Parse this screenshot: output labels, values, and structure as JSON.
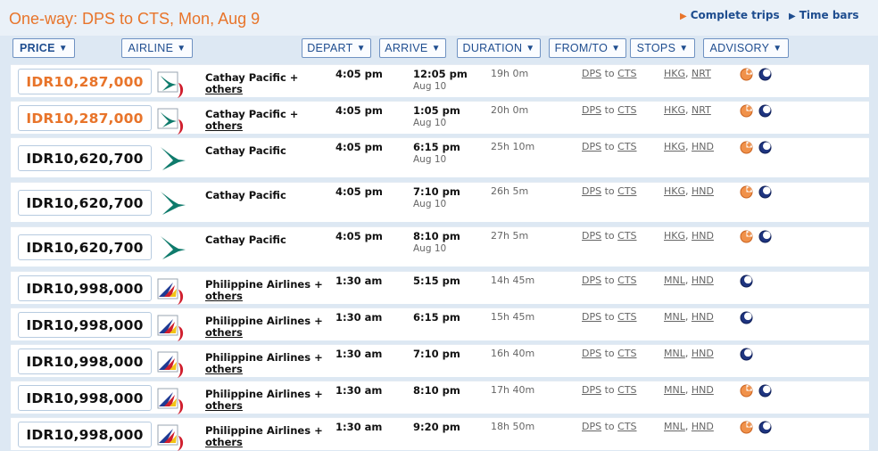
{
  "header": {
    "title": "One-way: DPS to CTS, Mon, Aug 9",
    "links": {
      "complete_trips": "Complete trips",
      "time_bars": "Time bars"
    }
  },
  "columns": [
    {
      "label": "PRICE",
      "name": "price",
      "active": true
    },
    {
      "label": "AIRLINE",
      "name": "airline",
      "active": false
    },
    {
      "label": "DEPART",
      "name": "depart",
      "active": false
    },
    {
      "label": "ARRIVE",
      "name": "arrive",
      "active": false
    },
    {
      "label": "DURATION",
      "name": "duration",
      "active": false
    },
    {
      "label": "FROM/TO",
      "name": "from-to",
      "active": false
    },
    {
      "label": "STOPS",
      "name": "stops",
      "active": false
    },
    {
      "label": "ADVISORY",
      "name": "advisory",
      "active": false
    }
  ],
  "common": {
    "to_word": "to"
  },
  "colors": {
    "accent": "#e8742a",
    "link": "#1e4d8f",
    "cathay_green": "#0f7b6c",
    "philippine_red": "#d01f2e",
    "philippine_blue": "#1f3a93"
  },
  "flights": [
    {
      "price": "IDR10,287,000",
      "highlight": true,
      "logo": "cathay-multi-icon",
      "airline_main": "Cathay Pacific +",
      "airline_extra": "others",
      "depart": "4:05 pm",
      "arrive": "12:05 pm",
      "arrive_date": "Aug 10",
      "duration": "19h 0m",
      "from": "DPS",
      "to": "CTS",
      "stops": [
        "HKG",
        "NRT"
      ],
      "advisory": [
        "sun-moon-icon",
        "moon-icon"
      ]
    },
    {
      "price": "IDR10,287,000",
      "highlight": true,
      "logo": "cathay-multi-icon",
      "airline_main": "Cathay Pacific +",
      "airline_extra": "others",
      "depart": "4:05 pm",
      "arrive": "1:05 pm",
      "arrive_date": "Aug 10",
      "duration": "20h 0m",
      "from": "DPS",
      "to": "CTS",
      "stops": [
        "HKG",
        "NRT"
      ],
      "advisory": [
        "sun-moon-icon",
        "moon-icon"
      ]
    },
    {
      "price": "IDR10,620,700",
      "highlight": false,
      "logo": "cathay-icon",
      "airline_main": "Cathay Pacific",
      "airline_extra": "",
      "depart": "4:05 pm",
      "arrive": "6:15 pm",
      "arrive_date": "Aug 10",
      "duration": "25h 10m",
      "from": "DPS",
      "to": "CTS",
      "stops": [
        "HKG",
        "HND"
      ],
      "advisory": [
        "sun-moon-icon",
        "moon-icon"
      ]
    },
    {
      "price": "IDR10,620,700",
      "highlight": false,
      "logo": "cathay-icon",
      "airline_main": "Cathay Pacific",
      "airline_extra": "",
      "depart": "4:05 pm",
      "arrive": "7:10 pm",
      "arrive_date": "Aug 10",
      "duration": "26h 5m",
      "from": "DPS",
      "to": "CTS",
      "stops": [
        "HKG",
        "HND"
      ],
      "advisory": [
        "sun-moon-icon",
        "moon-icon"
      ]
    },
    {
      "price": "IDR10,620,700",
      "highlight": false,
      "logo": "cathay-icon",
      "airline_main": "Cathay Pacific",
      "airline_extra": "",
      "depart": "4:05 pm",
      "arrive": "8:10 pm",
      "arrive_date": "Aug 10",
      "duration": "27h 5m",
      "from": "DPS",
      "to": "CTS",
      "stops": [
        "HKG",
        "HND"
      ],
      "advisory": [
        "sun-moon-icon",
        "moon-icon"
      ]
    },
    {
      "price": "IDR10,998,000",
      "highlight": false,
      "logo": "philippine-multi-icon",
      "airline_main": "Philippine Airlines +",
      "airline_extra": "others",
      "depart": "1:30 am",
      "arrive": "5:15 pm",
      "arrive_date": "",
      "duration": "14h 45m",
      "from": "DPS",
      "to": "CTS",
      "stops": [
        "MNL",
        "HND"
      ],
      "advisory": [
        "moon-icon"
      ]
    },
    {
      "price": "IDR10,998,000",
      "highlight": false,
      "logo": "philippine-multi-icon",
      "airline_main": "Philippine Airlines +",
      "airline_extra": "others",
      "depart": "1:30 am",
      "arrive": "6:15 pm",
      "arrive_date": "",
      "duration": "15h 45m",
      "from": "DPS",
      "to": "CTS",
      "stops": [
        "MNL",
        "HND"
      ],
      "advisory": [
        "moon-icon"
      ]
    },
    {
      "price": "IDR10,998,000",
      "highlight": false,
      "logo": "philippine-multi-icon",
      "airline_main": "Philippine Airlines +",
      "airline_extra": "others",
      "depart": "1:30 am",
      "arrive": "7:10 pm",
      "arrive_date": "",
      "duration": "16h 40m",
      "from": "DPS",
      "to": "CTS",
      "stops": [
        "MNL",
        "HND"
      ],
      "advisory": [
        "moon-icon"
      ]
    },
    {
      "price": "IDR10,998,000",
      "highlight": false,
      "logo": "philippine-multi-icon",
      "airline_main": "Philippine Airlines +",
      "airline_extra": "others",
      "depart": "1:30 am",
      "arrive": "8:10 pm",
      "arrive_date": "",
      "duration": "17h 40m",
      "from": "DPS",
      "to": "CTS",
      "stops": [
        "MNL",
        "HND"
      ],
      "advisory": [
        "sun-moon-icon",
        "moon-icon"
      ]
    },
    {
      "price": "IDR10,998,000",
      "highlight": false,
      "logo": "philippine-multi-icon",
      "airline_main": "Philippine Airlines +",
      "airline_extra": "others",
      "depart": "1:30 am",
      "arrive": "9:20 pm",
      "arrive_date": "",
      "duration": "18h 50m",
      "from": "DPS",
      "to": "CTS",
      "stops": [
        "MNL",
        "HND"
      ],
      "advisory": [
        "sun-moon-icon",
        "moon-icon"
      ]
    }
  ]
}
